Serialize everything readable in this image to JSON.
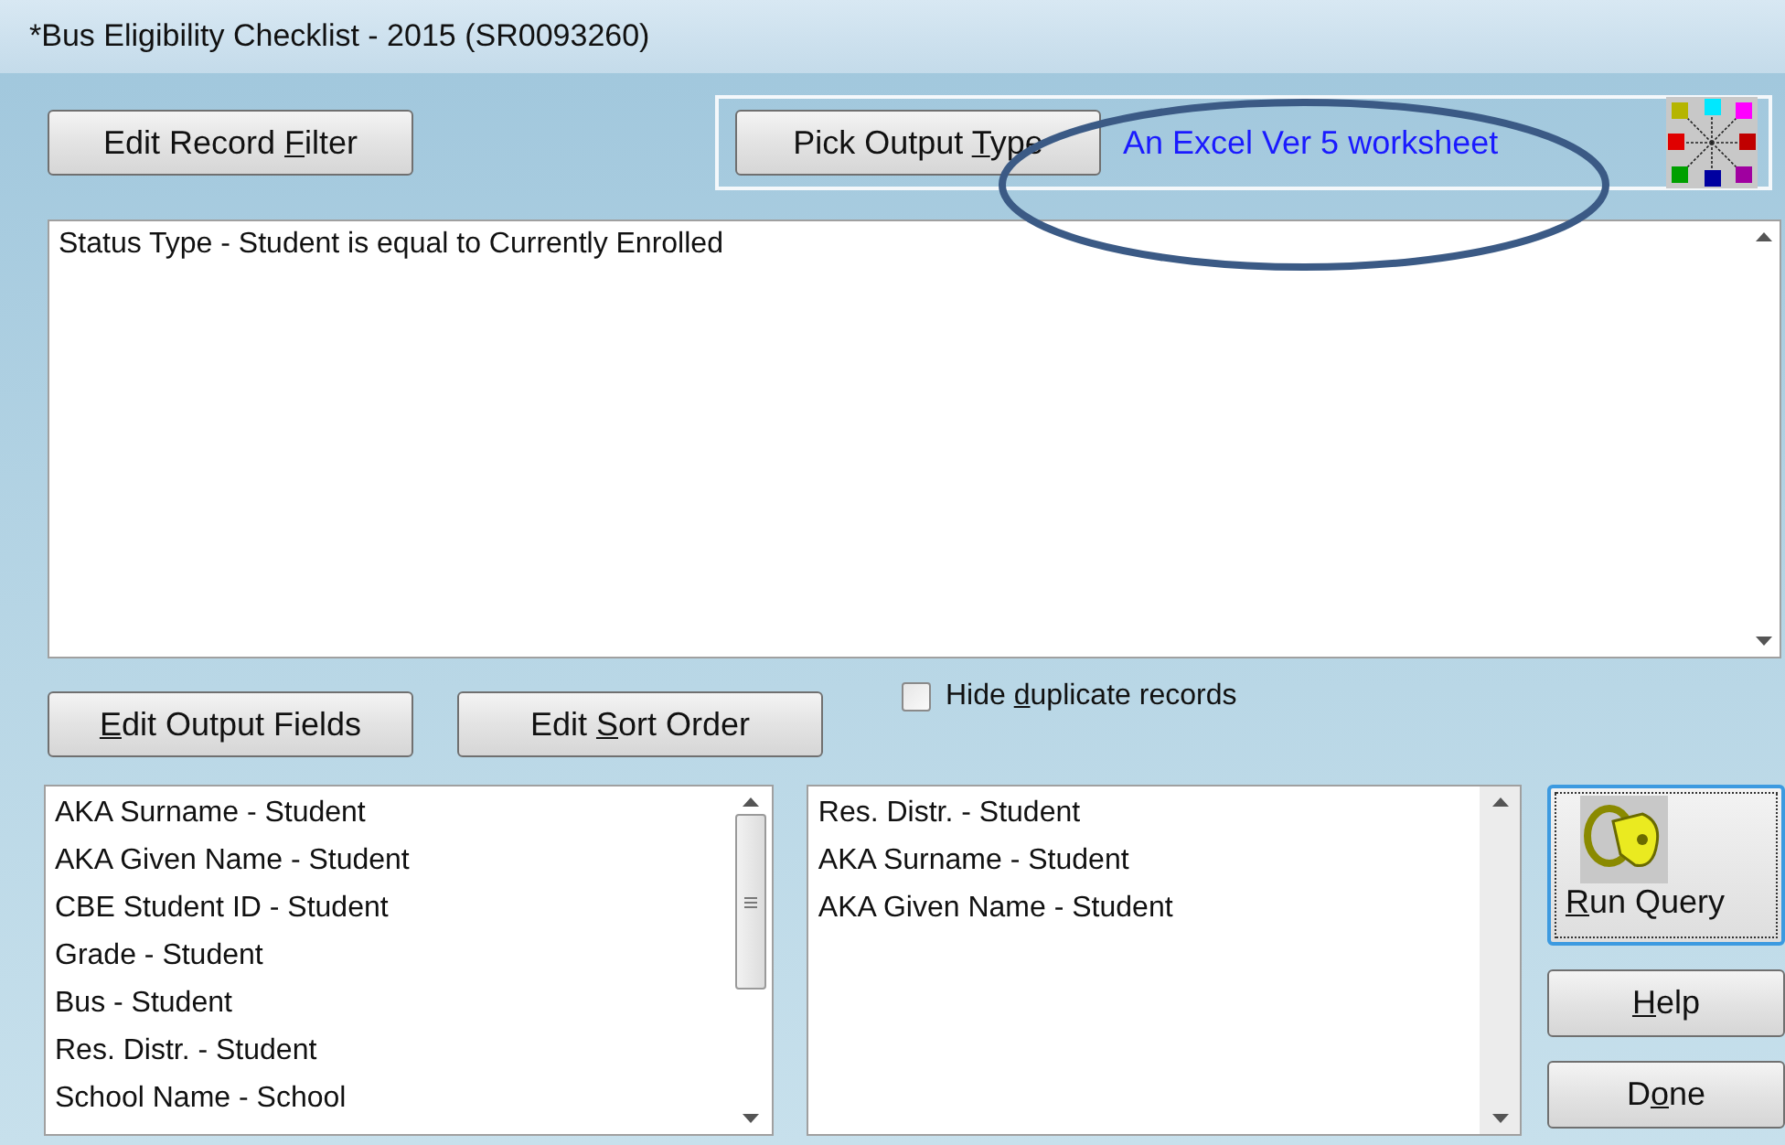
{
  "window": {
    "title": "*Bus Eligibility Checklist - 2015 (SR0093260)"
  },
  "filter_button": {
    "label": "Edit Record Filter"
  },
  "output_type": {
    "button": {
      "label": "Pick Output Type"
    },
    "value": "An Excel Ver 5 worksheet"
  },
  "filter_text": "Status Type - Student is equal to Currently Enrolled",
  "output_fields_button": {
    "label": "Edit Output Fields"
  },
  "sort_order_button": {
    "label": "Edit Sort Order"
  },
  "hide_duplicates": {
    "label": "Hide duplicate records",
    "checked": false
  },
  "output_fields": [
    "AKA Surname - Student",
    "AKA Given Name - Student",
    "CBE Student ID - Student",
    "Grade - Student",
    "Bus - Student",
    "Res. Distr. - Student",
    "School Name - School"
  ],
  "sort_fields": [
    "Res. Distr. - Student",
    "AKA Surname - Student",
    "AKA Given Name - Student"
  ],
  "actions": [
    {
      "kind": "run",
      "label": "Run Query",
      "focused": true
    },
    {
      "kind": "plain",
      "label": "Help",
      "focused": false
    },
    {
      "kind": "plain",
      "label": "Done",
      "focused": false
    }
  ],
  "annotation": {
    "kind": "ellipse"
  }
}
